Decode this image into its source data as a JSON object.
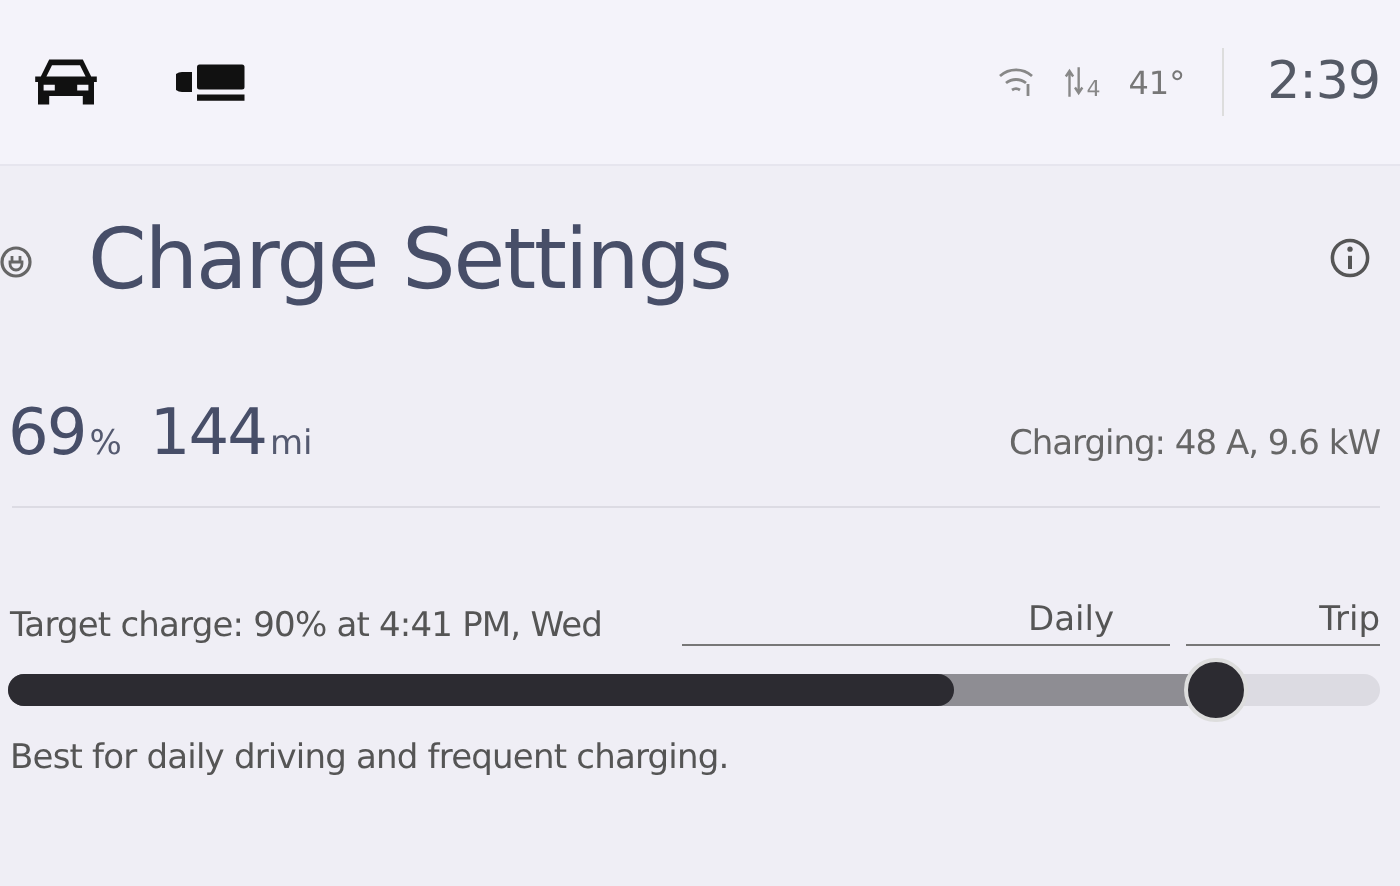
{
  "status_bar": {
    "temperature": "41°",
    "network": "4",
    "time": "2:39"
  },
  "title": "Charge Settings",
  "summary": {
    "percent": "69",
    "percent_unit": "%",
    "range": "144",
    "range_unit": "mi",
    "charging": "Charging: 48 A, 9.6 kW"
  },
  "target": {
    "label": "Target charge: 90% at 4:41 PM, Wed",
    "zones": [
      {
        "label": "Daily"
      },
      {
        "label": "Trip"
      }
    ],
    "current_charge": {
      "level": 0.69
    },
    "slider": {
      "level": 0.88
    },
    "description": "Best for daily driving and frequent charging."
  }
}
